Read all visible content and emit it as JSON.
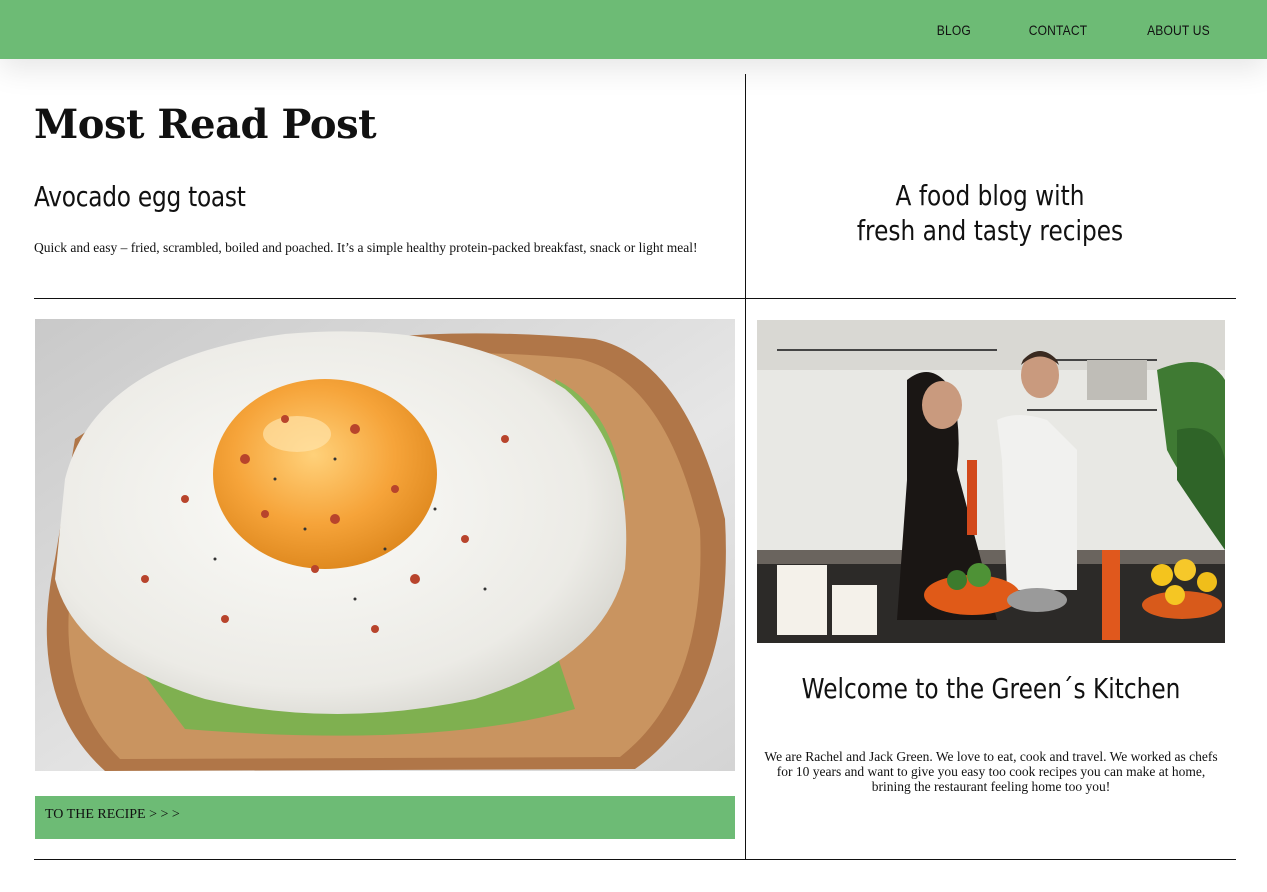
{
  "nav": {
    "items": [
      {
        "label": "BLOG"
      },
      {
        "label": "CONTACT"
      },
      {
        "label": "ABOUT US"
      }
    ]
  },
  "colors": {
    "accent": "#6dbb75",
    "text": "#111111",
    "background": "#ffffff"
  },
  "main": {
    "section_title": "Most Read Post",
    "post": {
      "title": "Avocado egg toast",
      "excerpt": "Quick and easy – fried, scrambled, boiled and poached. It’s a simple healthy protein-packed breakfast, snack or light meal!",
      "cta_label": "TO THE RECIPE > > >"
    }
  },
  "sidebar": {
    "tagline_line1": "A food blog with",
    "tagline_line2": "fresh and tasty recipes",
    "welcome_title": "Welcome to the Green´s Kitchen",
    "about_text": "We are Rachel and Jack Green. We love to eat, cook and travel. We worked as chefs for 10 years and want to give you easy too cook recipes you can make at home, brining the restaurant feeling home too you!"
  }
}
